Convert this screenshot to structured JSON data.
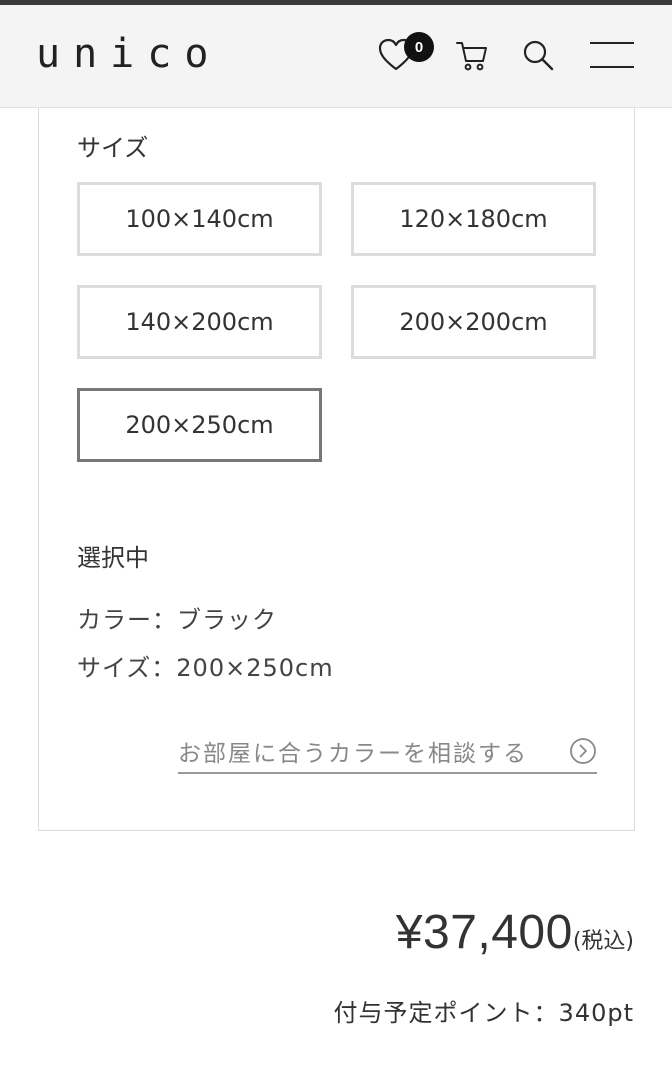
{
  "header": {
    "logo": "unico",
    "favorite_count": "0",
    "icons": [
      "heart-icon",
      "cart-icon",
      "search-icon",
      "menu-icon"
    ]
  },
  "size_section": {
    "label": "サイズ",
    "options": [
      {
        "label": "100×140cm",
        "selected": false
      },
      {
        "label": "120×180cm",
        "selected": false
      },
      {
        "label": "140×200cm",
        "selected": false
      },
      {
        "label": "200×200cm",
        "selected": false
      },
      {
        "label": "200×250cm",
        "selected": true
      }
    ]
  },
  "selection": {
    "label": "選択中",
    "color_line": "カラー：ブラック",
    "size_line": "サイズ：200×250cm"
  },
  "consult_link": {
    "label": "お部屋に合うカラーを相談する"
  },
  "pricing": {
    "price": "¥37,400",
    "tax_note": "(税込)",
    "points": "付与予定ポイント：340pt"
  },
  "colors": {
    "text": "#333333",
    "selected_border": "#777777",
    "option_border": "#dcdcdc",
    "header_bg": "#f4f4f4"
  }
}
